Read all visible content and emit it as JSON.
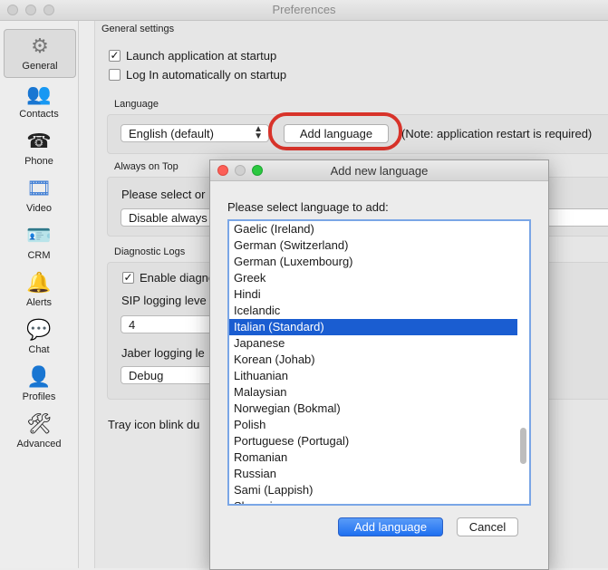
{
  "window": {
    "title": "Preferences"
  },
  "sidebar": {
    "items": [
      {
        "label": "General",
        "icon": "gear-icon",
        "glyph": "⚙",
        "selected": true
      },
      {
        "label": "Contacts",
        "icon": "contacts-icon",
        "glyph": "👥"
      },
      {
        "label": "Phone",
        "icon": "phone-icon",
        "glyph": "☎"
      },
      {
        "label": "Video",
        "icon": "video-icon",
        "glyph": "🎞"
      },
      {
        "label": "CRM",
        "icon": "crm-icon",
        "glyph": "🪪"
      },
      {
        "label": "Alerts",
        "icon": "bell-icon",
        "glyph": "🔔"
      },
      {
        "label": "Chat",
        "icon": "chat-bubble-icon",
        "glyph": "💬"
      },
      {
        "label": "Profiles",
        "icon": "profiles-icon",
        "glyph": "👤"
      },
      {
        "label": "Advanced",
        "icon": "tools-icon",
        "glyph": "🛠"
      }
    ]
  },
  "general": {
    "section_title": "General settings",
    "launch_at_startup": {
      "label": "Launch application at startup",
      "checked": true
    },
    "login_automatically": {
      "label": "Log In automatically on startup",
      "checked": false
    },
    "language": {
      "title": "Language",
      "selected": "English (default)",
      "add_button": "Add language",
      "note": "(Note: application restart is required)"
    },
    "always_on_top": {
      "title": "Always on Top",
      "prompt": "Please select or",
      "selected": "Disable always"
    },
    "diagnostic_logs": {
      "title": "Diagnostic Logs",
      "enable_label": "Enable diagno",
      "enable_checked": true,
      "sip_label": "SIP logging leve",
      "sip_value": "4",
      "jabber_label": "Jaber logging le",
      "jabber_value": "Debug"
    },
    "tray_icon_label": "Tray icon blink du"
  },
  "dialog": {
    "title": "Add new language",
    "prompt": "Please select language to add:",
    "languages": [
      "Gaelic (Ireland)",
      "German (Switzerland)",
      "German (Luxembourg)",
      "Greek",
      "Hindi",
      "Icelandic",
      "Italian (Standard)",
      "Japanese",
      "Korean (Johab)",
      "Lithuanian",
      "Malaysian",
      "Norwegian (Bokmal)",
      "Polish",
      "Portuguese (Portugal)",
      "Romanian",
      "Russian",
      "Sami (Lappish)",
      "Slovenian"
    ],
    "selected_language": "Italian (Standard)",
    "add_button": "Add language",
    "cancel_button": "Cancel",
    "accent_color": "#1a5dd1"
  },
  "annotation_color": "#d8332a"
}
